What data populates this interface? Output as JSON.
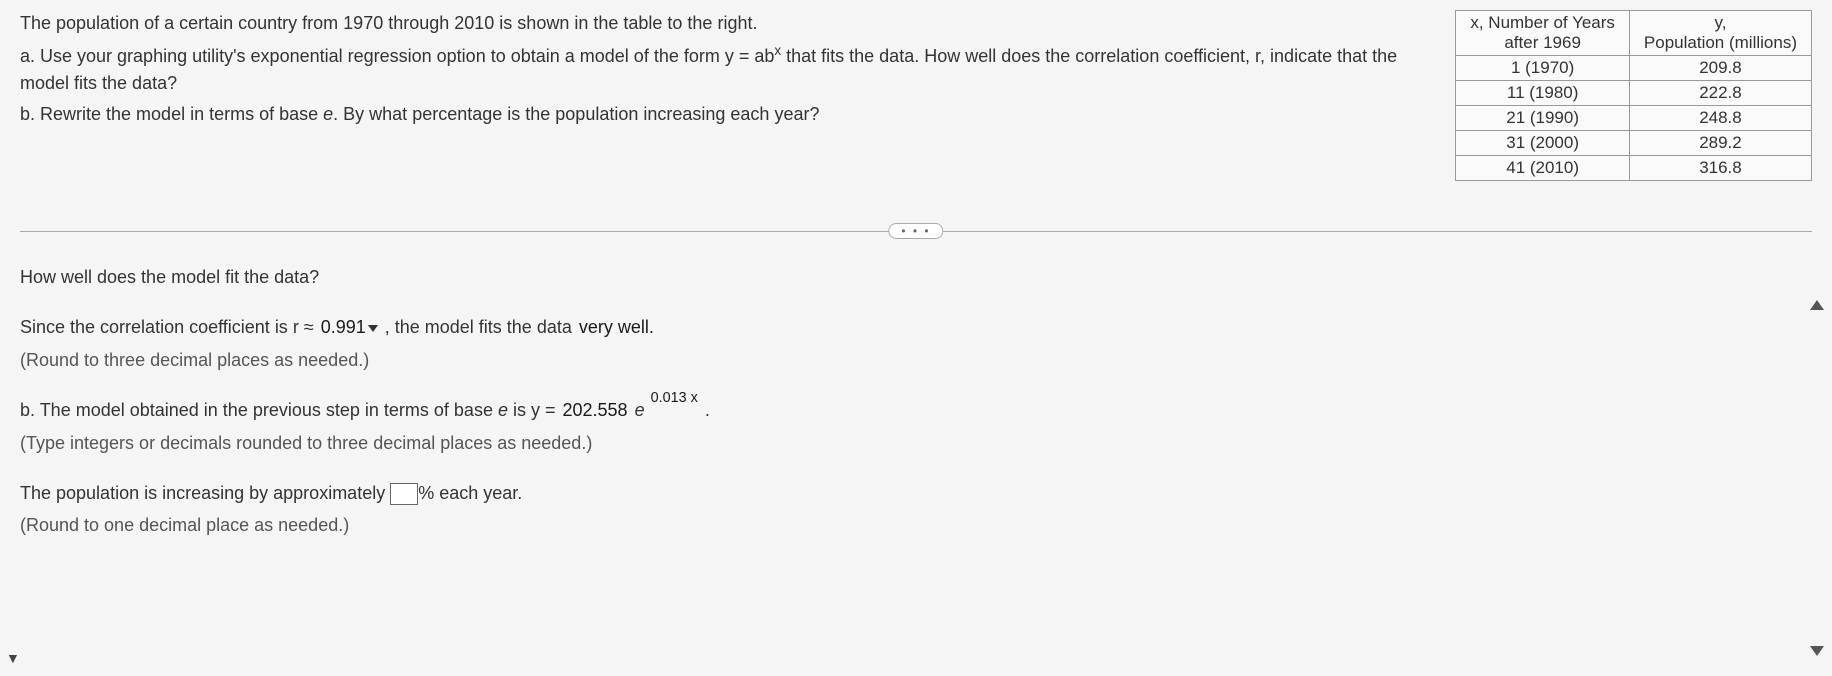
{
  "problem": {
    "intro": "The population of a certain country from 1970 through 2010 is shown in the table to the right.",
    "part_a_prefix": "a. Use your graphing utility's exponential regression option to obtain a model of the form y = ab",
    "part_a_sup": "x",
    "part_a_suffix": " that fits the data. How well does the correlation coefficient, r, indicate that the model fits the data?",
    "part_b_prefix": "b. Rewrite the model in terms of base ",
    "part_b_e": "e",
    "part_b_suffix": ". By what percentage is the population increasing each year?"
  },
  "table": {
    "header_x_line1": "x, Number of Years",
    "header_x_line2": "after 1969",
    "header_y_line1": "y,",
    "header_y_line2": "Population (millions)",
    "rows": [
      {
        "x": "1 (1970)",
        "y": "209.8"
      },
      {
        "x": "11 (1980)",
        "y": "222.8"
      },
      {
        "x": "21 (1990)",
        "y": "248.8"
      },
      {
        "x": "31 (2000)",
        "y": "289.2"
      },
      {
        "x": "41 (2010)",
        "y": "316.8"
      }
    ]
  },
  "divider": {
    "toggle": "• • •"
  },
  "answers": {
    "q1": "How well does the model fit the data?",
    "line1_prefix": "Since the correlation coefficient is r ≈ ",
    "r_value": "0.991",
    "line1_mid": " , the model fits the data ",
    "fit_quality": "very well.",
    "round3": "(Round to three decimal places as needed.)",
    "partb_prefix": "b. The model obtained in the previous step in terms of base ",
    "e": "e",
    "partb_mid": " is y = ",
    "coef": "202.558",
    "e2": " e",
    "exponent": "0.013 x",
    "period": " .",
    "type_instr": "(Type integers or decimals rounded to three decimal places as needed.)",
    "pop_prefix": "The population is increasing by approximately ",
    "pop_suffix": "% each year.",
    "round1": "(Round to one decimal place as needed.)"
  }
}
